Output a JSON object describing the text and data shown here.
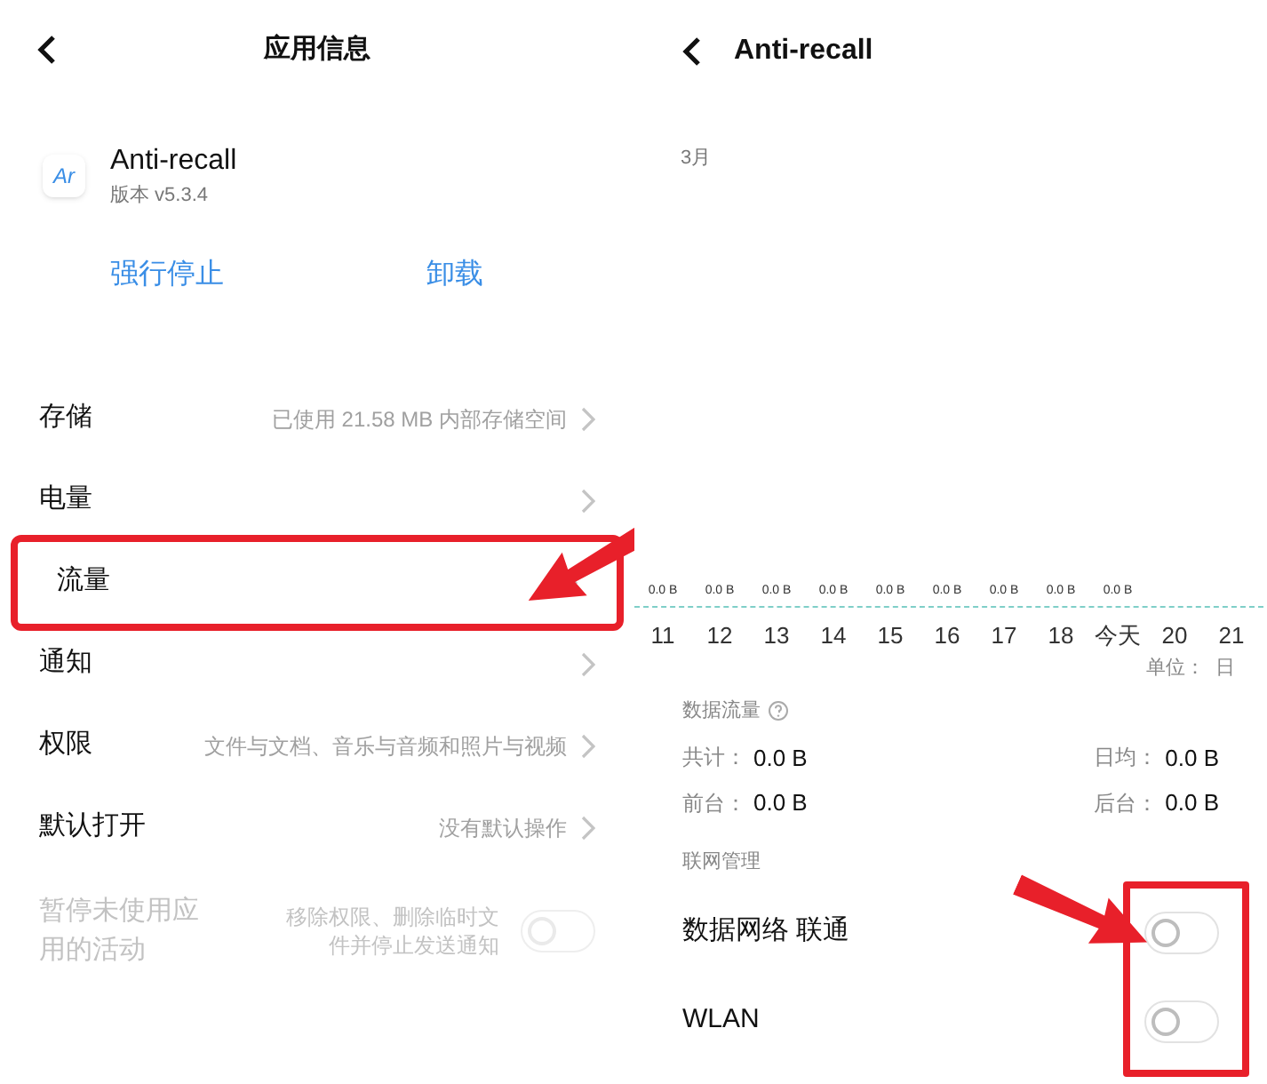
{
  "app_info": {
    "title": "应用信息",
    "app_icon_text": "Ar",
    "app_name": "Anti-recall",
    "version": "版本 v5.3.4",
    "actions": [
      "强行停止",
      "卸载"
    ],
    "rows": [
      {
        "label": "存储",
        "value": "已使用 21.58 MB 内部存储空间",
        "highlighted": false,
        "kind": "link"
      },
      {
        "label": "电量",
        "highlighted": false,
        "kind": "link"
      },
      {
        "label": "流量",
        "highlighted": true,
        "kind": "link"
      },
      {
        "label": "通知",
        "highlighted": false,
        "kind": "link"
      },
      {
        "label": "权限",
        "value": "文件与文档、音乐与音频和照片与视频",
        "highlighted": false,
        "kind": "link"
      },
      {
        "label": "默认打开",
        "value": "没有默认操作",
        "highlighted": false,
        "kind": "link"
      },
      {
        "label": "暂停未使用应用的活动",
        "value": "移除权限、删除临时文件并停止发送通知",
        "highlighted": false,
        "kind": "toggle",
        "on": false,
        "disabled": true
      }
    ]
  },
  "traffic": {
    "title": "Anti-recall",
    "month": "3月",
    "days": [
      {
        "label": "11",
        "value": "0.0 B"
      },
      {
        "label": "12",
        "value": "0.0 B"
      },
      {
        "label": "13",
        "value": "0.0 B"
      },
      {
        "label": "14",
        "value": "0.0 B"
      },
      {
        "label": "15",
        "value": "0.0 B"
      },
      {
        "label": "16",
        "value": "0.0 B"
      },
      {
        "label": "17",
        "value": "0.0 B"
      },
      {
        "label": "18",
        "value": "0.0 B"
      },
      {
        "label": "今天",
        "value": "0.0 B"
      },
      {
        "label": "20"
      },
      {
        "label": "21"
      }
    ],
    "unit": "单位：  日",
    "section_title": "数据流量",
    "stats": [
      {
        "label": "共计：",
        "value": "0.0 B"
      },
      {
        "label": "日均：",
        "value": "0.0 B"
      },
      {
        "label": "前台：",
        "value": "0.0 B"
      },
      {
        "label": "后台：",
        "value": "0.0 B"
      }
    ],
    "network_title": "联网管理",
    "network_highlighted": true,
    "network": [
      {
        "label": "数据网络 联通",
        "on": false
      },
      {
        "label": "WLAN",
        "on": false
      }
    ]
  }
}
